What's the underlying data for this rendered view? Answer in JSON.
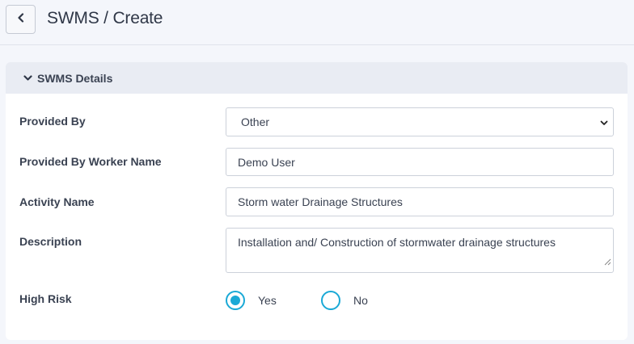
{
  "header": {
    "app": "SWMS",
    "separator": "/",
    "page": "Create"
  },
  "section": {
    "title": "SWMS Details"
  },
  "form": {
    "provided_by": {
      "label": "Provided By",
      "value": "Other"
    },
    "worker_name": {
      "label": "Provided By Worker Name",
      "value": "Demo User"
    },
    "activity_name": {
      "label": "Activity Name",
      "value": "Storm water Drainage Structures"
    },
    "description": {
      "label": "Description",
      "value": "Installation and/ Construction of stormwater drainage structures"
    },
    "high_risk": {
      "label": "High Risk",
      "options": [
        {
          "label": "Yes",
          "selected": true
        },
        {
          "label": "No",
          "selected": false
        }
      ]
    }
  },
  "colors": {
    "accent": "#1aa9d6",
    "page_bg": "#f4f6fb",
    "section_header_bg": "#e9ecf3",
    "text": "#3a4252"
  },
  "icons": {
    "back": "chevron-left-icon",
    "section_toggle": "chevron-down-icon",
    "select_arrow": "chevron-down-icon",
    "resize": "resize-grip-icon"
  }
}
